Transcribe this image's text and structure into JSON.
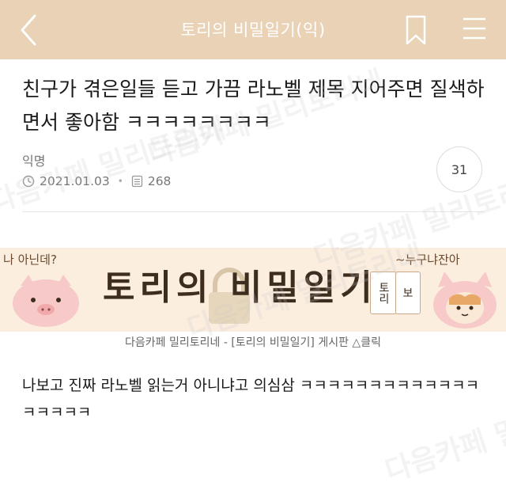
{
  "topbar": {
    "title": "토리의 비밀일기(익)",
    "bg": "#e9d2b6"
  },
  "post": {
    "title": "친구가 겪은일들 듣고 가끔 라노벨 제목 지어주면 질색하면서 좋아함 ㅋㅋㅋㅋㅋㅋㅋㅋ",
    "author": "익명",
    "date": "2021.01.03",
    "views": "268",
    "comments": "31"
  },
  "banner": {
    "title": "토리의 비밀일기",
    "left_speech": "나 아닌데?",
    "right_speech": "~누구냐잔아",
    "tag_left": "토리",
    "tag_right": "보"
  },
  "caption": "다음카페 밀리토리네 - [토리의 비밀일기] 게시판 △클릭",
  "body": "나보고 진짜 라노벨 읽는거 아니냐고 의심삼 ㅋㅋㅋㅋㅋㅋㅋㅋㅋㅋㅋㅋㅋㅋㅋㅋㅋㅋ",
  "watermark": "다음카페 밀리토리네"
}
